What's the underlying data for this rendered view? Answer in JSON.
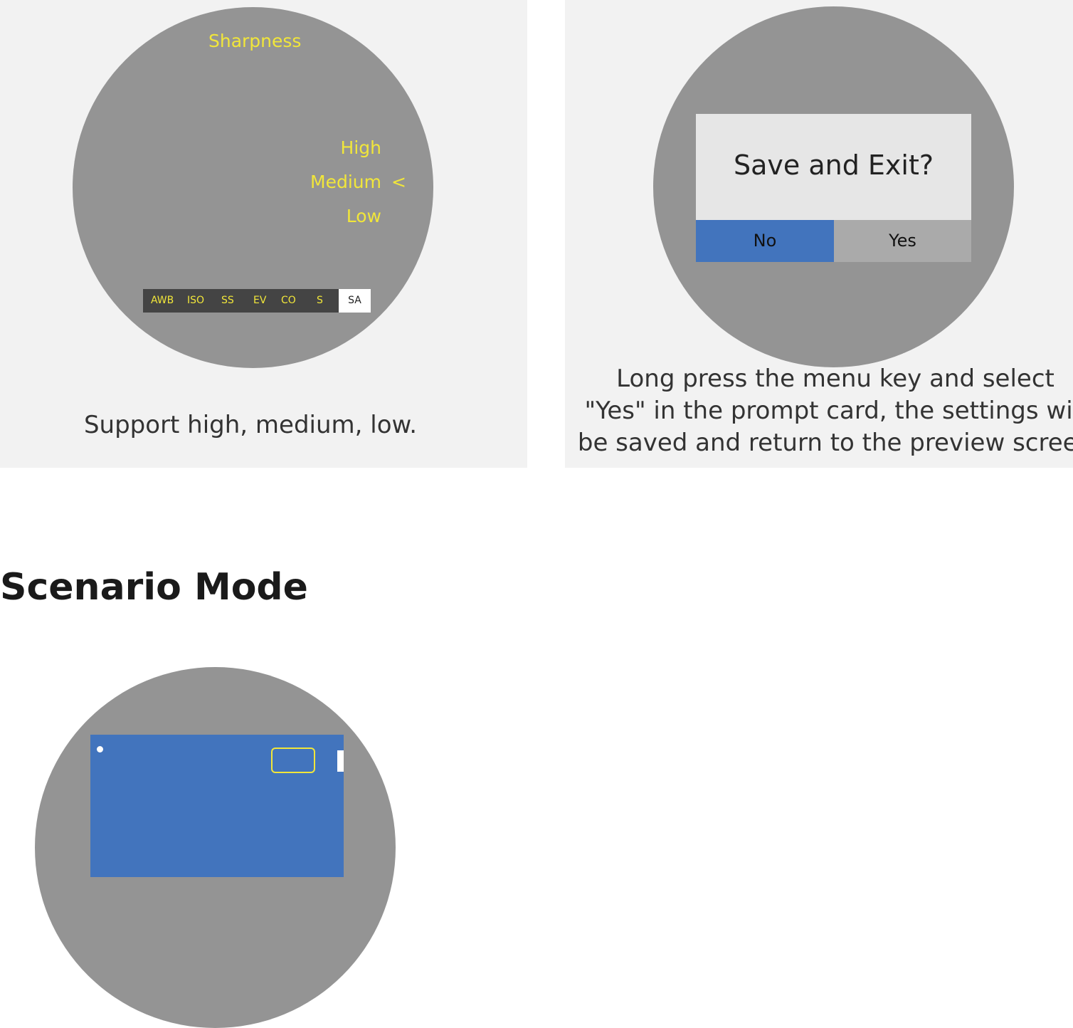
{
  "colors": {
    "panel_bg": "#f2f2f2",
    "screen_gray": "#949494",
    "accent_yellow": "#f1e63a",
    "accent_blue": "#4274bd",
    "yes_button_bg": "#aaaaaa",
    "menu_bar_bg": "#444444"
  },
  "left_panel": {
    "title": "Sharpness",
    "options": [
      {
        "label": "High"
      },
      {
        "label": "Medium"
      },
      {
        "label": "Low"
      }
    ],
    "selected_marker": "<",
    "menu_bar": [
      "AWB",
      "ISO",
      "SS",
      "EV",
      "CO",
      "S",
      "SA"
    ],
    "active_menu_item": "SA",
    "caption": "Support high, medium, low."
  },
  "right_panel": {
    "prompt_title": "Save and Exit?",
    "no_label": "No",
    "yes_label": "Yes",
    "caption_lines": [
      "Long press the menu key and select",
      "\"Yes\" in the prompt card, the settings will",
      "be saved and return to the preview screen"
    ]
  },
  "section": {
    "title": "Scenario Mode"
  }
}
